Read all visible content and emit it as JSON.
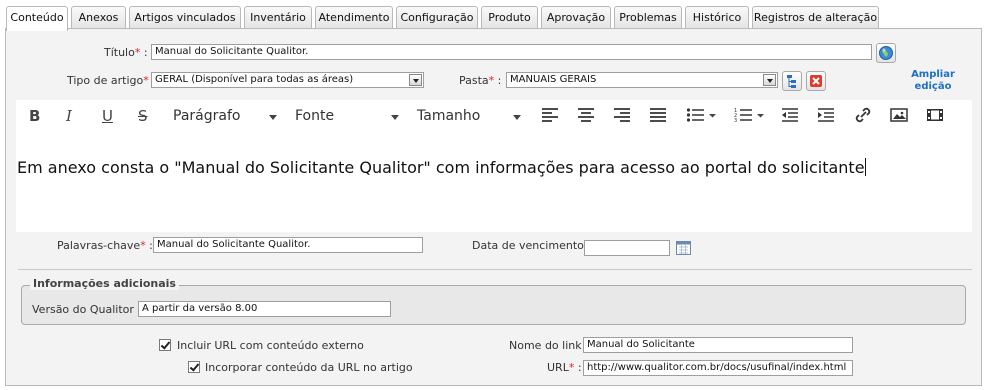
{
  "tabs": [
    {
      "label": "Conteúdo",
      "active": true
    },
    {
      "label": "Anexos"
    },
    {
      "label": "Artigos vinculados"
    },
    {
      "label": "Inventário"
    },
    {
      "label": "Atendimento"
    },
    {
      "label": "Configuração"
    },
    {
      "label": "Produto"
    },
    {
      "label": "Aprovação"
    },
    {
      "label": "Problemas"
    },
    {
      "label": "Histórico"
    },
    {
      "label": "Registros de alteração"
    }
  ],
  "form": {
    "titulo_label": "Título",
    "titulo_value": "Manual do Solicitante Qualitor.",
    "tipo_label": "Tipo de artigo",
    "tipo_value": "GERAL (Disponível para todas as áreas)",
    "pasta_label": "Pasta",
    "pasta_value": "MANUAIS GERAIS",
    "ampliar_line1": "Ampliar",
    "ampliar_line2": "edição",
    "palavras_label": "Palavras-chave",
    "palavras_value": "Manual do Solicitante Qualitor.",
    "vencimento_label": "Data de vencimento :",
    "vencimento_value": "",
    "info_legend": "Informações adicionais",
    "versao_label": "Versão do Qualitor :",
    "versao_value": "A partir da versão 8.00",
    "incluir_url_label": "Incluir URL com conteúdo externo",
    "incorporar_label": "Incorporar conteúdo da URL no artigo",
    "nome_link_label": "Nome do link :",
    "nome_link_value": "Manual do Solicitante",
    "url_label": "URL",
    "url_value": "http://www.qualitor.com.br/docs/usufinal/index.html",
    "required_mark": "*",
    "colon": " :"
  },
  "editor": {
    "paragraph_select": "Parágrafo",
    "font_select": "Fonte",
    "size_select": "Tamanho",
    "content": "Em anexo consta o \"Manual do Solicitante Qualitor\" com informações para acesso ao portal do solicitante"
  },
  "icons": {
    "bold": "B",
    "italic": "I",
    "underline": "U",
    "strike": "S"
  },
  "colors": {
    "required": "#e02020",
    "link": "#1e6fc8",
    "panel": "#f3f3f3"
  }
}
